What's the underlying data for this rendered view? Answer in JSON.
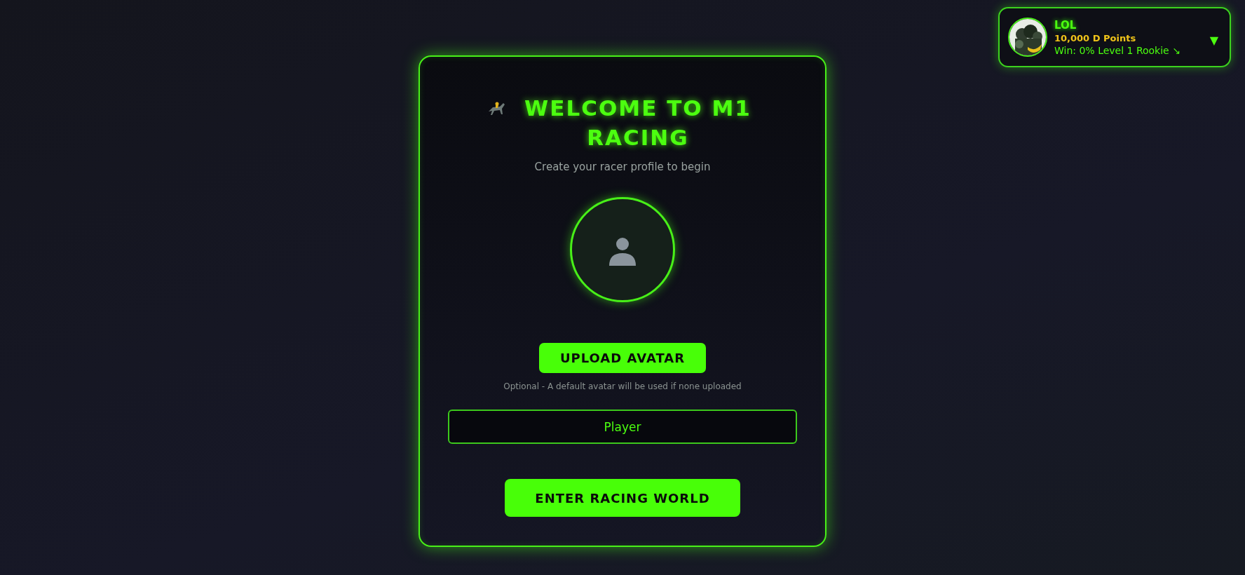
{
  "profile": {
    "name": "LOL",
    "points": "10,000 D Points",
    "stats": "Win: 0% Level 1 Rookie ↘",
    "menu": "▼"
  },
  "welcome": {
    "title": "WELCOME TO M1 RACING",
    "subtitle": "Create your racer profile to begin",
    "upload_button": "UPLOAD AVATAR",
    "upload_hint": "Optional - A default avatar will be used if none uploaded",
    "name_field": {
      "value": "Player"
    },
    "enter_button": "ENTER RACING WORLD"
  }
}
